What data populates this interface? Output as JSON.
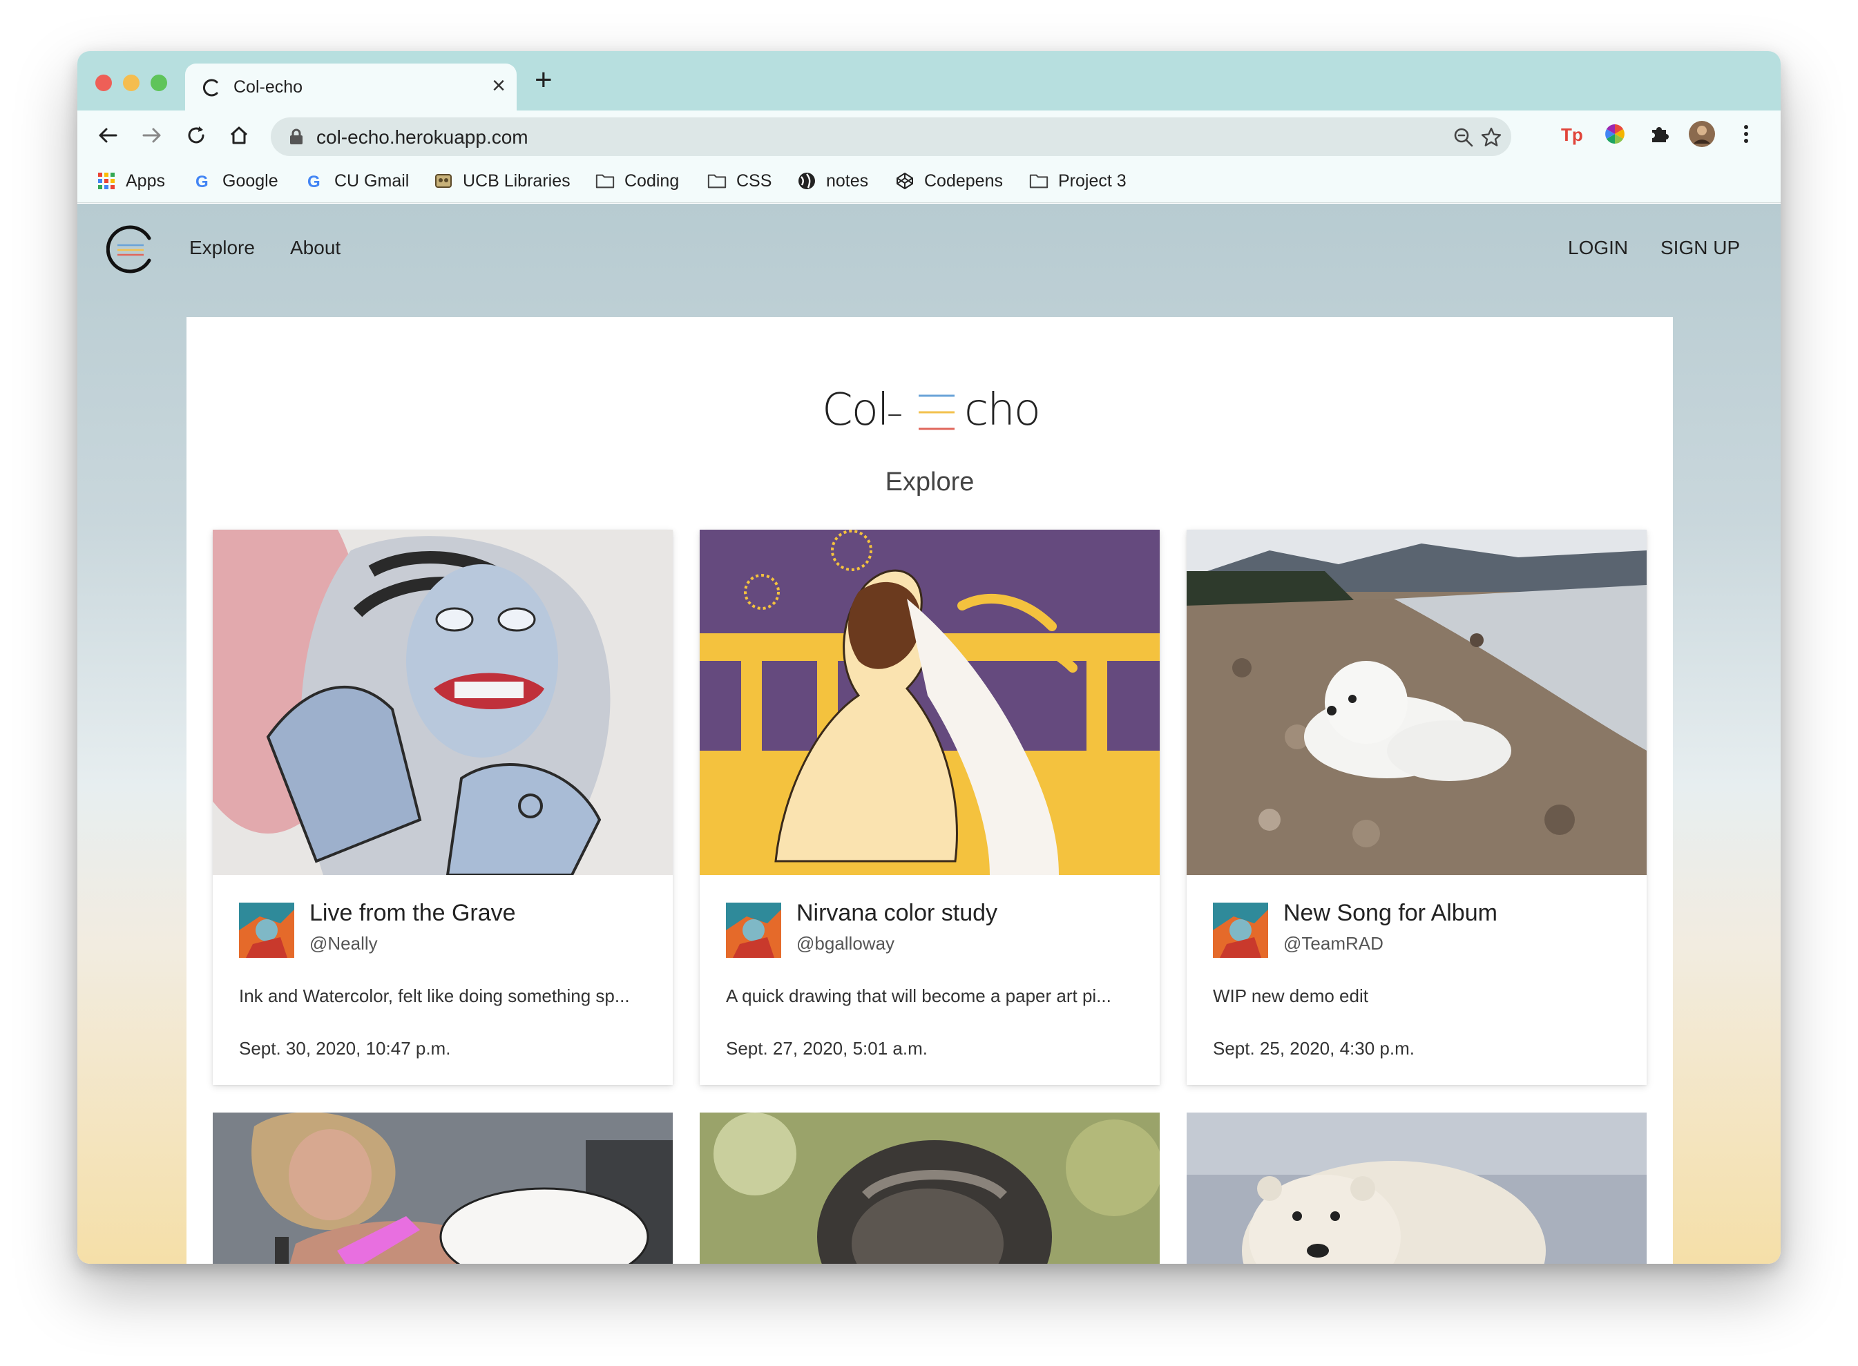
{
  "browser": {
    "tab_title": "Col-echo",
    "tab_close": "×",
    "new_tab": "+",
    "url": "col-echo.herokuapp.com",
    "bookmarks": [
      {
        "label": "Apps",
        "icon": "apps-grid-icon"
      },
      {
        "label": "Google",
        "icon": "google-icon"
      },
      {
        "label": "CU Gmail",
        "icon": "google-icon"
      },
      {
        "label": "UCB Libraries",
        "icon": "library-icon"
      },
      {
        "label": "Coding",
        "icon": "folder-icon"
      },
      {
        "label": "CSS",
        "icon": "folder-icon"
      },
      {
        "label": "notes",
        "icon": "globe-icon"
      },
      {
        "label": "Codepens",
        "icon": "codepen-icon"
      },
      {
        "label": "Project 3",
        "icon": "folder-icon"
      }
    ]
  },
  "site": {
    "nav": {
      "explore": "Explore",
      "about": "About",
      "login": "LOGIN",
      "signup": "SIGN UP"
    },
    "brand": {
      "left": "Col",
      "dash": "–",
      "right": "cho"
    },
    "section_title": "Explore",
    "posts": [
      {
        "title": "Live from the Grave",
        "handle": "@Neally",
        "description": "Ink and Watercolor, felt like doing something sp...",
        "date": "Sept. 30, 2020, 10:47 p.m."
      },
      {
        "title": "Nirvana color study",
        "handle": "@bgalloway",
        "description": "A quick drawing that will become a paper art pi...",
        "date": "Sept. 27, 2020, 5:01 a.m."
      },
      {
        "title": "New Song for Album",
        "handle": "@TeamRAD",
        "description": "WIP new demo edit",
        "date": "Sept. 25, 2020, 4:30 p.m."
      }
    ]
  },
  "colors": {
    "accent_blue": "#6aa3d8",
    "accent_yellow": "#f2c14e",
    "accent_red": "#e0675c"
  }
}
